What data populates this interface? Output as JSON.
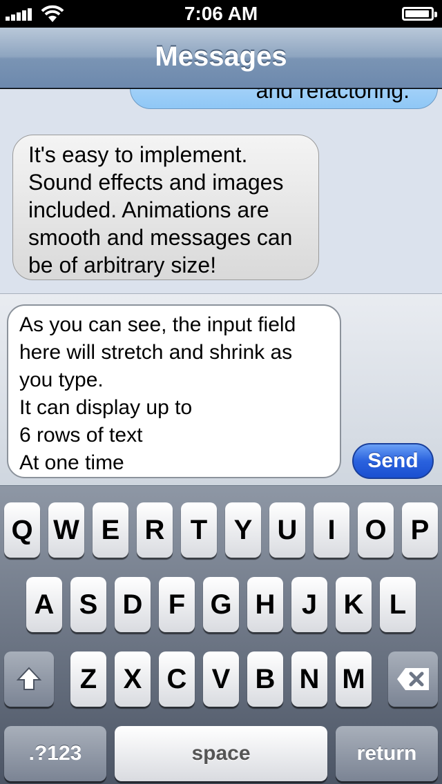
{
  "status_bar": {
    "time": "7:06 AM",
    "battery_level": 0.95
  },
  "nav": {
    "title": "Messages"
  },
  "conversation": {
    "messages": [
      {
        "direction": "outgoing",
        "text": "and refactoring."
      },
      {
        "direction": "incoming",
        "text": "It's easy to implement.\nSound effects and images\nincluded. Animations are\nsmooth and messages can\nbe of arbitrary size!"
      }
    ]
  },
  "composer": {
    "input_value": "As you can see, the input field\nhere will stretch and shrink as\nyou type.\nIt can display up to\n6 rows of text\nAt one time",
    "send_label": "Send"
  },
  "keyboard": {
    "row1": [
      "Q",
      "W",
      "E",
      "R",
      "T",
      "Y",
      "U",
      "I",
      "O",
      "P"
    ],
    "row2": [
      "A",
      "S",
      "D",
      "F",
      "G",
      "H",
      "J",
      "K",
      "L"
    ],
    "row3": [
      "Z",
      "X",
      "C",
      "V",
      "B",
      "N",
      "M"
    ],
    "shift_icon": "shift-arrow-icon",
    "delete_icon": "backspace-icon",
    "numbers_label": ".?123",
    "space_label": "space",
    "return_label": "return"
  },
  "colors": {
    "send_button": "#2a62de",
    "outgoing_bubble": "#8fc7f6",
    "incoming_bubble": "#d9d9d9"
  }
}
